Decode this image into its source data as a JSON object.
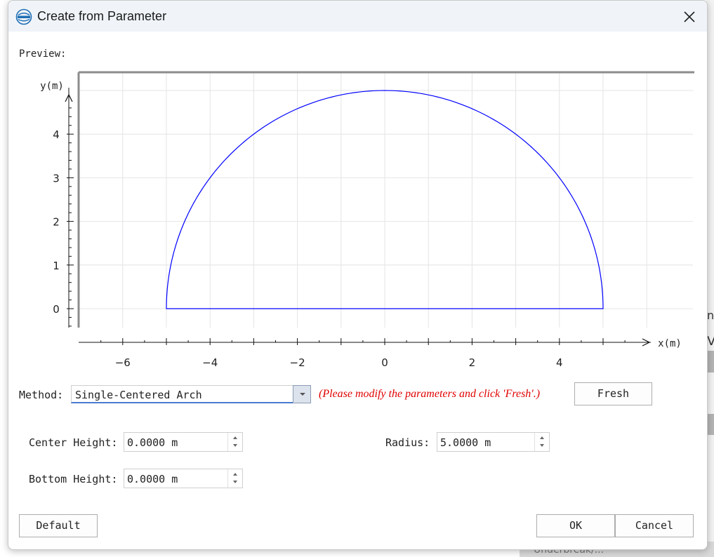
{
  "window": {
    "title": "Create from Parameter"
  },
  "preview": {
    "label": "Preview:"
  },
  "chart_data": {
    "type": "line",
    "xlabel": "x(m)",
    "ylabel": "y(m)",
    "xlim": [
      -7,
      7
    ],
    "ylim": [
      -0.4,
      5.4
    ],
    "x_ticks": [
      -6,
      -4,
      -2,
      0,
      2,
      4
    ],
    "y_ticks": [
      0,
      1,
      2,
      3,
      4
    ],
    "grid": true,
    "legend": "none",
    "series": [
      {
        "shape": "semicircle-arch",
        "center_x": 0,
        "center_y": 0,
        "radius": 5,
        "color": "#0000ff"
      }
    ]
  },
  "method": {
    "label": "Method:",
    "selected": "Single-Centered Arch",
    "hint": "(Please modify the parameters and click 'Fresh'.)",
    "fresh_label": "Fresh"
  },
  "fields": {
    "center_height": {
      "label": "Center Height:",
      "value": "0.0000 m"
    },
    "bottom_height": {
      "label": "Bottom Height:",
      "value": "0.0000 m"
    },
    "radius": {
      "label": "Radius:",
      "value": "5.0000 m"
    }
  },
  "buttons": {
    "default": "Default",
    "ok": "OK",
    "cancel": "Cancel"
  },
  "background": {
    "fragment_top": "nt",
    "fragment_mid": "Va",
    "bottom_tab": "Underbreak/..."
  },
  "colors": {
    "curve": "#0000ff",
    "hint": "#e00000",
    "titlebar": "#f0f4f9",
    "logo": "#1f6fb4"
  }
}
